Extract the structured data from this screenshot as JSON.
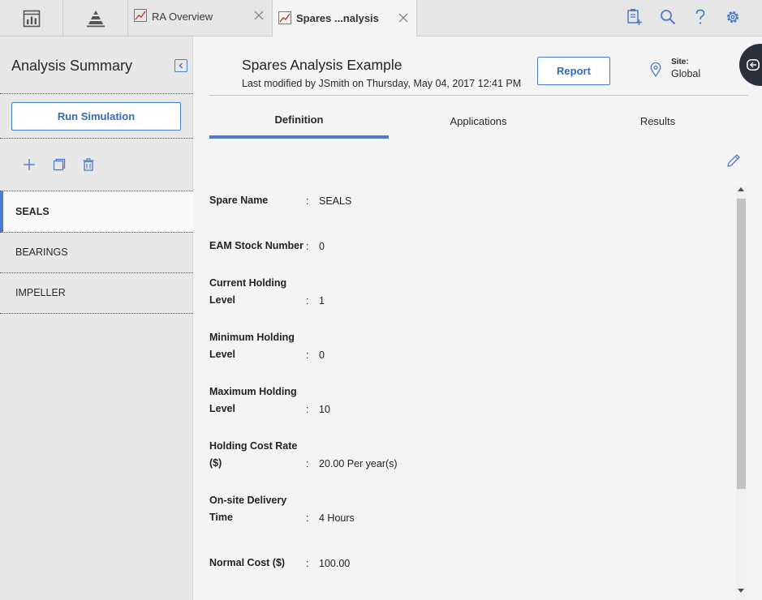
{
  "topbar": {
    "tabs": [
      {
        "label": "RA Overview",
        "icon": "chart-line-icon"
      },
      {
        "label": "Spares ...nalysis",
        "icon": "chart-line-icon"
      }
    ],
    "left_icons": [
      "dashboard-icon",
      "asset-pyramid-icon"
    ],
    "right_icons": [
      "add-document-icon",
      "search-icon",
      "help-icon",
      "gear-icon"
    ]
  },
  "sidebar": {
    "title": "Analysis Summary",
    "run_button": "Run Simulation",
    "tools": [
      "plus-icon",
      "copy-icon",
      "trash-icon"
    ],
    "items": [
      {
        "label": "SEALS",
        "selected": true
      },
      {
        "label": "BEARINGS",
        "selected": false
      },
      {
        "label": "IMPELLER",
        "selected": false
      }
    ]
  },
  "main": {
    "title": "Spares Analysis Example",
    "subtitle": "Last modified by JSmith on Thursday, May 04, 2017 12:41 PM",
    "report_button": "Report",
    "site_label": "Site:",
    "site_value": "Global",
    "tabs": [
      {
        "label": "Definition",
        "active": true
      },
      {
        "label": "Applications",
        "active": false
      },
      {
        "label": "Results",
        "active": false
      }
    ],
    "fields": [
      {
        "label_line1": "Spare Name",
        "label_line2": "",
        "value": "SEALS"
      },
      {
        "label_line1": "EAM Stock Number",
        "label_line2": "",
        "value": "0"
      },
      {
        "label_line1": "Current Holding",
        "label_line2": "Level",
        "value": "1"
      },
      {
        "label_line1": "Minimum Holding",
        "label_line2": "Level",
        "value": "0"
      },
      {
        "label_line1": "Maximum Holding",
        "label_line2": "Level",
        "value": "10"
      },
      {
        "label_line1": "Holding Cost Rate",
        "label_line2": "($)",
        "value": "20.00 Per year(s)"
      },
      {
        "label_line1": "On-site Delivery",
        "label_line2": "Time",
        "value": "4 Hours"
      },
      {
        "label_line1": "Normal Cost ($)",
        "label_line2": "",
        "value": "100.00"
      }
    ],
    "colon": ":"
  },
  "colors": {
    "accent": "#4a7bd0",
    "brand_red": "#c0392b",
    "dark_button": "#2b2f3a"
  }
}
